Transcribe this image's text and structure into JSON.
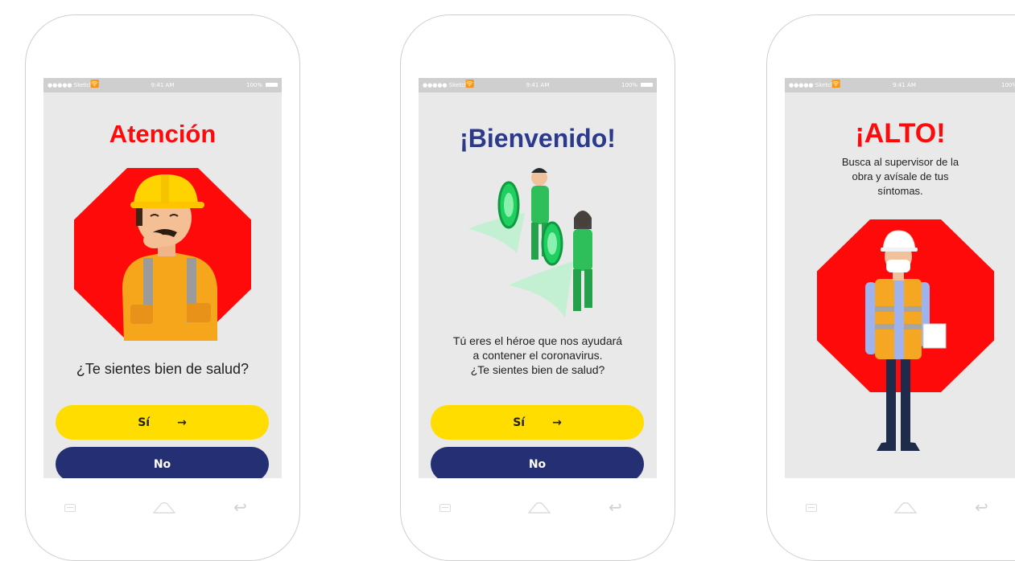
{
  "status_bar": {
    "carrier": "●●●●● Sketch",
    "time": "9:41 AM",
    "battery": "100%"
  },
  "screens": [
    {
      "title": "Atención",
      "question": "¿Te sientes bien de salud?",
      "yes_label": "Sí",
      "no_label": "No"
    },
    {
      "title": "¡Bienvenido!",
      "message_line1": "Tú eres el héroe que nos ayudará",
      "message_line2": "a contener el coronavirus.",
      "message_line3": "¿Te sientes bien de salud?",
      "yes_label": "Sí",
      "no_label": "No"
    },
    {
      "title": "¡ALTO!",
      "message_line1": "Busca al supervisor de la",
      "message_line2": "obra y avísale de tus",
      "message_line3": "síntomas."
    }
  ],
  "colors": {
    "red": "#fe0a0a",
    "navy": "#252f73",
    "yellow": "#ffdd00",
    "title_blue": "#2b3a8a",
    "screen_bg": "#e9e9e9"
  },
  "icons": [
    "wifi-icon",
    "battery-icon",
    "arrow-right-icon",
    "menu-nav-icon",
    "home-nav-icon",
    "back-nav-icon"
  ]
}
